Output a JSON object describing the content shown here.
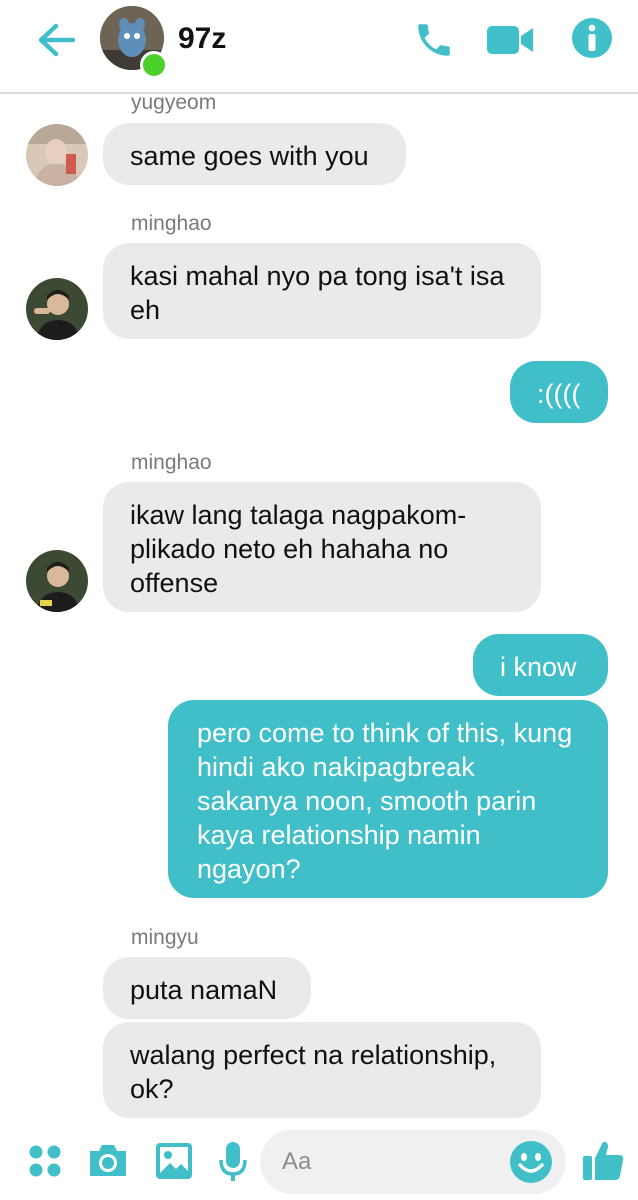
{
  "header": {
    "title": "97z",
    "icons": {
      "back": "back-arrow-icon",
      "call": "phone-icon",
      "video": "video-camera-icon",
      "info": "info-icon"
    },
    "accent_color": "#41bfc9",
    "online_color": "#4cd12b"
  },
  "messages": [
    {
      "sender": "yugyeom",
      "text": "same goes with you",
      "direction": "incoming"
    },
    {
      "sender": "minghao",
      "text": "kasi mahal nyo pa tong isa't isa eh",
      "direction": "incoming"
    },
    {
      "sender": "",
      "text": ":((((",
      "direction": "outgoing"
    },
    {
      "sender": "minghao",
      "text": "ikaw lang talaga nagpakom-plikado neto eh hahaha no offense",
      "direction": "incoming"
    },
    {
      "sender": "",
      "text": "i know",
      "direction": "outgoing"
    },
    {
      "sender": "",
      "text": "pero come to think of this, kung hindi ako nakipagbreak sakanya noon, smooth parin kaya relationship namin ngayon?",
      "direction": "outgoing"
    },
    {
      "sender": "mingyu",
      "text": "puta namaN",
      "direction": "incoming"
    },
    {
      "sender": "mingyu",
      "text": "walang perfect na relationship, ok?",
      "direction": "incoming"
    }
  ],
  "composer": {
    "placeholder": "Aa",
    "icons": [
      "apps-icon",
      "camera-icon",
      "image-icon",
      "microphone-icon",
      "emoji-icon",
      "thumbs-up-icon"
    ]
  },
  "colors": {
    "incoming_bubble": "#eaeaea",
    "outgoing_bubble": "#41bfc9"
  }
}
